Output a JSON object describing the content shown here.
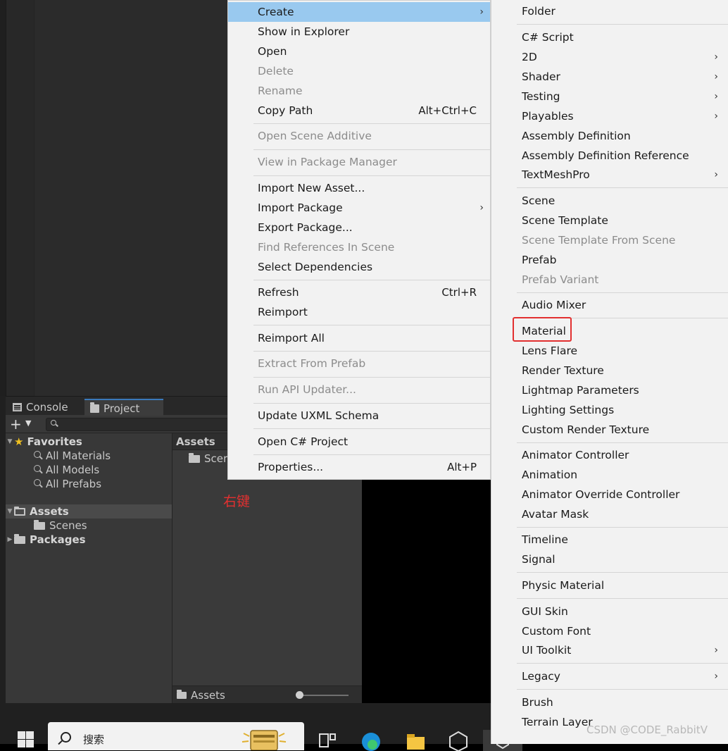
{
  "project_panel": {
    "tabs": {
      "console": "Console",
      "project": "Project"
    },
    "add_label": "+",
    "tree": {
      "favorites": "Favorites",
      "all_materials": "All Materials",
      "all_models": "All Models",
      "all_prefabs": "All Prefabs",
      "assets": "Assets",
      "scenes": "Scenes",
      "packages": "Packages"
    },
    "assets_header": "Assets",
    "assets_item": "Scer",
    "breadcrumb": "Assets",
    "zoom_level": 0
  },
  "annotation": "右键",
  "taskbar": {
    "search_placeholder": "搜索"
  },
  "context_menu": {
    "create": "Create",
    "show_in_explorer": "Show in Explorer",
    "open": "Open",
    "delete": "Delete",
    "rename": "Rename",
    "copy_path": "Copy Path",
    "copy_path_shortcut": "Alt+Ctrl+C",
    "open_scene_additive": "Open Scene Additive",
    "view_in_package_manager": "View in Package Manager",
    "import_new_asset": "Import New Asset...",
    "import_package": "Import Package",
    "export_package": "Export Package...",
    "find_references": "Find References In Scene",
    "select_dependencies": "Select Dependencies",
    "refresh": "Refresh",
    "refresh_shortcut": "Ctrl+R",
    "reimport": "Reimport",
    "reimport_all": "Reimport All",
    "extract_from_prefab": "Extract From Prefab",
    "run_api_updater": "Run API Updater...",
    "update_uxml_schema": "Update UXML Schema",
    "open_csharp_project": "Open C# Project",
    "properties": "Properties...",
    "properties_shortcut": "Alt+P"
  },
  "create_submenu": {
    "folder": "Folder",
    "csharp_script": "C# Script",
    "2d": "2D",
    "shader": "Shader",
    "testing": "Testing",
    "playables": "Playables",
    "assembly_definition": "Assembly Definition",
    "assembly_definition_reference": "Assembly Definition Reference",
    "textmeshpro": "TextMeshPro",
    "scene": "Scene",
    "scene_template": "Scene Template",
    "scene_template_from_scene": "Scene Template From Scene",
    "prefab": "Prefab",
    "prefab_variant": "Prefab Variant",
    "audio_mixer": "Audio Mixer",
    "material": "Material",
    "lens_flare": "Lens Flare",
    "render_texture": "Render Texture",
    "lightmap_parameters": "Lightmap Parameters",
    "lighting_settings": "Lighting Settings",
    "custom_render_texture": "Custom Render Texture",
    "animator_controller": "Animator Controller",
    "animation": "Animation",
    "animator_override_controller": "Animator Override Controller",
    "avatar_mask": "Avatar Mask",
    "timeline": "Timeline",
    "signal": "Signal",
    "physic_material": "Physic Material",
    "gui_skin": "GUI Skin",
    "custom_font": "Custom Font",
    "ui_toolkit": "UI Toolkit",
    "legacy": "Legacy",
    "brush": "Brush",
    "terrain_layer": "Terrain Layer"
  },
  "watermark": "CSDN @CODE_RabbitV",
  "colors": {
    "menu_bg": "#f2f2f2",
    "menu_highlight": "#99c9ef",
    "annotation_red": "#e23030",
    "editor_dark": "#383838",
    "tab_accent": "#3a79bb"
  }
}
